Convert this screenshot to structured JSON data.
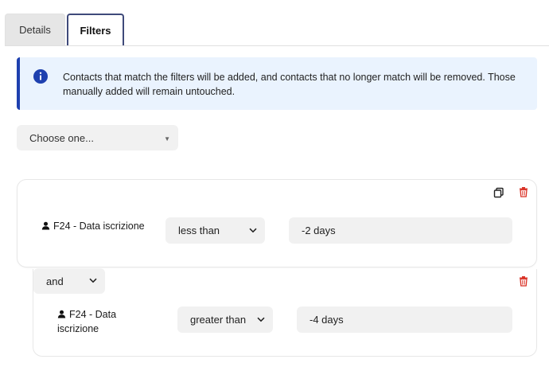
{
  "tabs": [
    {
      "label": "Details"
    },
    {
      "label": "Filters"
    }
  ],
  "info": {
    "text": "Contacts that match the filters will be added, and contacts that no longer match will be removed. Those manually added will remain untouched."
  },
  "choose": {
    "label": "Choose one..."
  },
  "filters": [
    {
      "field": "F24 - Data iscrizione",
      "operator": "less than",
      "value": "-2 days"
    },
    {
      "conjunction": "and",
      "field_line1": "F24 - Data",
      "field_line2": "iscrizione",
      "operator": "greater than",
      "value": "-4 days"
    }
  ],
  "colors": {
    "accent": "#1e40af",
    "info_bg": "#eaf3fe",
    "delete": "#d93025",
    "field_bg": "#f1f1f1"
  },
  "icons": [
    "info-icon",
    "copy-icon",
    "trash-icon",
    "person-icon",
    "chevron-down-icon"
  ]
}
